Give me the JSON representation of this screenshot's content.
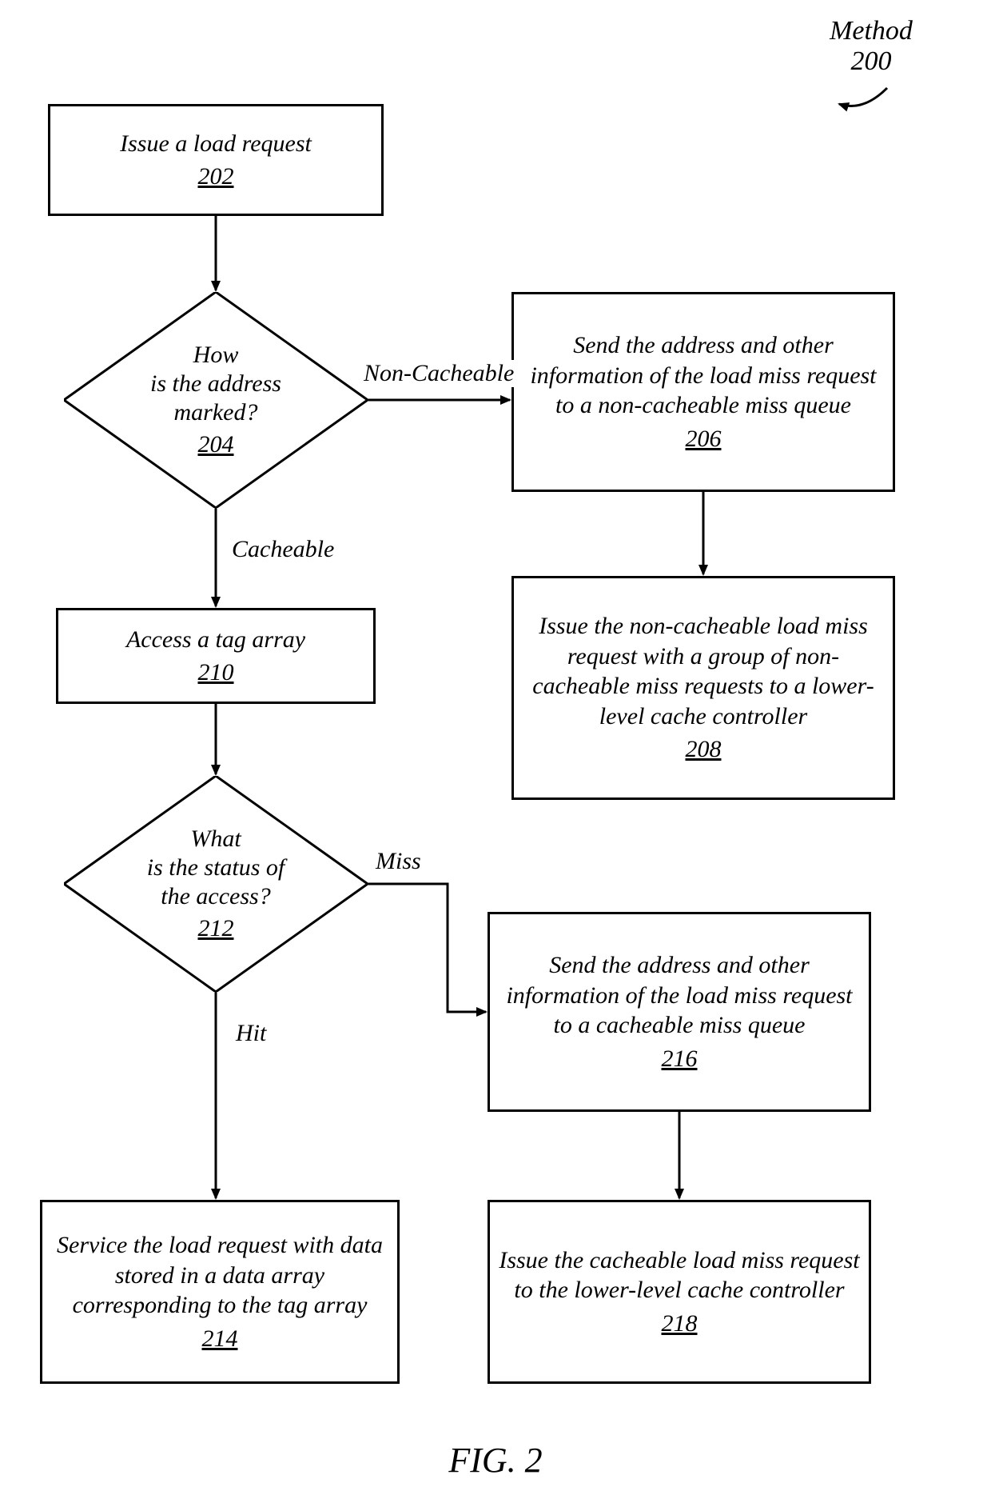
{
  "meta": {
    "title": "Method",
    "title_ref": "200",
    "figure_caption": "FIG. 2"
  },
  "nodes": {
    "n202": {
      "text": "Issue a load request",
      "ref": "202"
    },
    "n204": {
      "text_l1": "How",
      "text_l2": "is the address",
      "text_l3": "marked?",
      "ref": "204"
    },
    "n206": {
      "text": "Send the address and other information of the load miss request to a non-cacheable miss queue",
      "ref": "206"
    },
    "n208": {
      "text": "Issue the non-cacheable load miss request with a group of non-cacheable miss requests to a lower-level cache controller",
      "ref": "208"
    },
    "n210": {
      "text": "Access a tag array",
      "ref": "210"
    },
    "n212": {
      "text_l1": "What",
      "text_l2": "is the status of",
      "text_l3": "the access?",
      "ref": "212"
    },
    "n214": {
      "text": "Service the load request with data stored in a data array corresponding to the tag array",
      "ref": "214"
    },
    "n216": {
      "text": "Send the address and other information of the load miss request to a cacheable miss queue",
      "ref": "216"
    },
    "n218": {
      "text": "Issue the cacheable load miss request to the lower-level cache controller",
      "ref": "218"
    }
  },
  "edges": {
    "e204_206": "Non-Cacheable",
    "e204_210": "Cacheable",
    "e212_216": "Miss",
    "e212_214": "Hit"
  },
  "chart_data": {
    "type": "flowchart",
    "title": "Method 200",
    "nodes": [
      {
        "id": "202",
        "type": "process",
        "label": "Issue a load request"
      },
      {
        "id": "204",
        "type": "decision",
        "label": "How is the address marked?"
      },
      {
        "id": "206",
        "type": "process",
        "label": "Send the address and other information of the load miss request to a non-cacheable miss queue"
      },
      {
        "id": "208",
        "type": "process",
        "label": "Issue the non-cacheable load miss request with a group of non-cacheable miss requests to a lower-level cache controller"
      },
      {
        "id": "210",
        "type": "process",
        "label": "Access a tag array"
      },
      {
        "id": "212",
        "type": "decision",
        "label": "What is the status of the access?"
      },
      {
        "id": "214",
        "type": "process",
        "label": "Service the load request with data stored in a data array corresponding to the tag array"
      },
      {
        "id": "216",
        "type": "process",
        "label": "Send the address and other information of the load miss request to a cacheable miss queue"
      },
      {
        "id": "218",
        "type": "process",
        "label": "Issue the cacheable load miss request to the lower-level cache controller"
      }
    ],
    "edges": [
      {
        "from": "202",
        "to": "204",
        "label": ""
      },
      {
        "from": "204",
        "to": "206",
        "label": "Non-Cacheable"
      },
      {
        "from": "204",
        "to": "210",
        "label": "Cacheable"
      },
      {
        "from": "206",
        "to": "208",
        "label": ""
      },
      {
        "from": "210",
        "to": "212",
        "label": ""
      },
      {
        "from": "212",
        "to": "216",
        "label": "Miss"
      },
      {
        "from": "212",
        "to": "214",
        "label": "Hit"
      },
      {
        "from": "216",
        "to": "218",
        "label": ""
      }
    ]
  }
}
